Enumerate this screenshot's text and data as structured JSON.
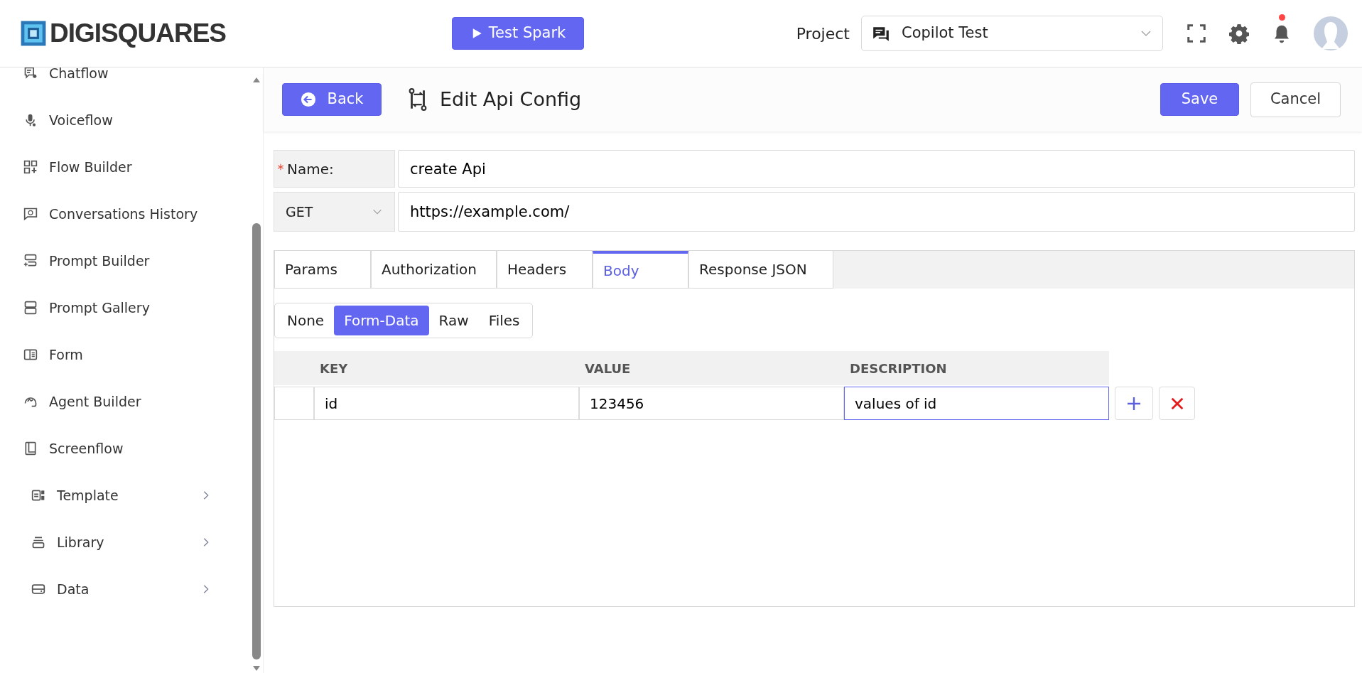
{
  "header": {
    "brand": "DIGISQUARES",
    "test_button": "Test Spark",
    "project_label": "Project",
    "project_value": "Copilot Test",
    "has_notifications": true
  },
  "sidebar": {
    "items": [
      {
        "label": "Chatflow",
        "kind": "link"
      },
      {
        "label": "Voiceflow",
        "kind": "link"
      },
      {
        "label": "Flow Builder",
        "kind": "link"
      },
      {
        "label": "Conversations History",
        "kind": "link"
      },
      {
        "label": "Prompt Builder",
        "kind": "link"
      },
      {
        "label": "Prompt Gallery",
        "kind": "link"
      },
      {
        "label": "Form",
        "kind": "link"
      },
      {
        "label": "Agent Builder",
        "kind": "link"
      },
      {
        "label": "Screenflow",
        "kind": "link"
      },
      {
        "label": "Template",
        "kind": "group"
      },
      {
        "label": "Library",
        "kind": "group"
      },
      {
        "label": "Data",
        "kind": "group"
      }
    ]
  },
  "toolbar": {
    "back": "Back",
    "title": "Edit Api Config",
    "save": "Save",
    "cancel": "Cancel"
  },
  "form": {
    "name_label": "Name:",
    "required": true,
    "name_value": "create Api",
    "method": "GET",
    "url": "https://example.com/"
  },
  "tabs": [
    {
      "label": "Params",
      "selected": false
    },
    {
      "label": "Authorization",
      "selected": false
    },
    {
      "label": "Headers",
      "selected": false
    },
    {
      "label": "Body",
      "selected": true
    },
    {
      "label": "Response JSON",
      "selected": false
    }
  ],
  "body_modes": [
    {
      "label": "None",
      "selected": false
    },
    {
      "label": "Form-Data",
      "selected": true
    },
    {
      "label": "Raw",
      "selected": false
    },
    {
      "label": "Files",
      "selected": false
    }
  ],
  "table": {
    "columns": [
      "KEY",
      "VALUE",
      "DESCRIPTION"
    ],
    "rows": [
      {
        "cells": [
          {
            "value": "id",
            "focused": false
          },
          {
            "value": "123456",
            "focused": false
          },
          {
            "value": "values of id",
            "focused": true
          }
        ]
      }
    ]
  }
}
